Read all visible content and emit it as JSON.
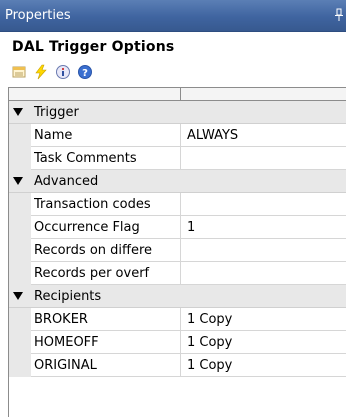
{
  "window": {
    "title": "Properties",
    "pin_icon": "pin-icon"
  },
  "panel": {
    "header": "DAL Trigger Options"
  },
  "toolbar": {
    "buttons": [
      {
        "icon": "categorized-icon"
      },
      {
        "icon": "events-lightning-icon"
      },
      {
        "icon": "info-icon"
      },
      {
        "icon": "help-icon"
      }
    ]
  },
  "grid": {
    "categories": [
      {
        "name": "Trigger",
        "rows": [
          {
            "name": "Name",
            "value": "ALWAYS"
          },
          {
            "name": "Task Comments",
            "value": ""
          }
        ]
      },
      {
        "name": "Advanced",
        "rows": [
          {
            "name": "Transaction codes",
            "value": ""
          },
          {
            "name": "Occurrence Flag",
            "value": "1"
          },
          {
            "name": "Records on differe",
            "value": ""
          },
          {
            "name": "Records per overf",
            "value": ""
          }
        ]
      },
      {
        "name": "Recipients",
        "rows": [
          {
            "name": "BROKER",
            "value": "1 Copy"
          },
          {
            "name": "HOMEOFF",
            "value": "1 Copy"
          },
          {
            "name": "ORIGINAL",
            "value": "1 Copy"
          }
        ]
      }
    ]
  },
  "colors": {
    "titlebar": "#3f64a0",
    "category_bg": "#e8e8e8"
  }
}
